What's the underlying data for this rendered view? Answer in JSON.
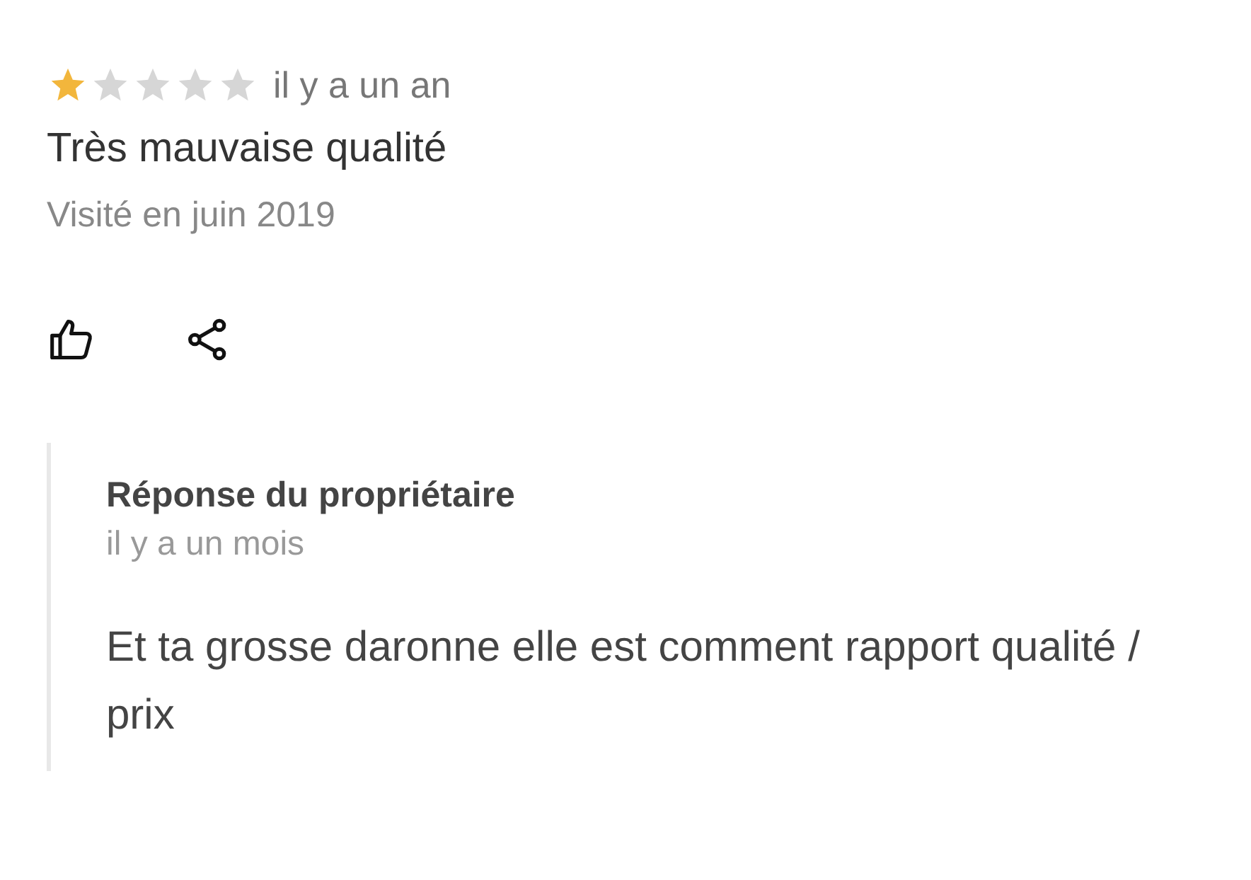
{
  "review": {
    "stars": 1,
    "time": "il y a un an",
    "title": "Très mauvaise qualité",
    "visited": "Visité en juin 2019"
  },
  "actions": [
    {
      "kind": "like"
    },
    {
      "kind": "share"
    }
  ],
  "owner_response": {
    "heading": "Réponse du propriétaire",
    "time": "il y a un mois",
    "text": "Et ta grosse daronne elle est comment rapport qualité / prix"
  }
}
